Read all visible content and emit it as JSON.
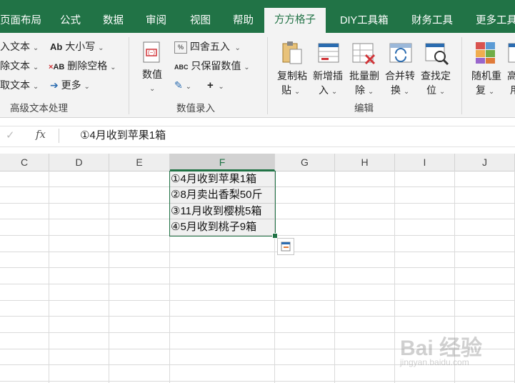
{
  "tabs": [
    {
      "label": "页面布局"
    },
    {
      "label": "公式"
    },
    {
      "label": "数据"
    },
    {
      "label": "审阅"
    },
    {
      "label": "视图"
    },
    {
      "label": "帮助"
    },
    {
      "label": "方方格子"
    },
    {
      "label": "DIY工具箱"
    },
    {
      "label": "财务工具"
    },
    {
      "label": "更多工具"
    }
  ],
  "active_tab": "方方格子",
  "ribbon": {
    "text_group": {
      "left_items": [
        "入文本",
        "除文本",
        "取文本"
      ],
      "case_label": "大小写",
      "remove_space_label": "删除空格",
      "more_label": "更多",
      "group_label": "高级文本处理"
    },
    "number_group": {
      "value_label": "数值",
      "round_label": "四舍五入",
      "keep_value_label": "只保留数值",
      "group_label": "数值录入"
    },
    "edit_group": {
      "copy_paste_line1": "复制粘",
      "copy_paste_line2": "贴",
      "insert_line1": "新增插",
      "insert_line2": "入",
      "batch_delete_line1": "批量删",
      "batch_delete_line2": "除",
      "merge_line1": "合并转",
      "merge_line2": "换",
      "find_line1": "查找定",
      "find_line2": "位",
      "group_label": "编辑"
    },
    "more_group": {
      "random_line1": "随机重",
      "random_line2": "复",
      "high_line1": "高",
      "high_line2": "用"
    }
  },
  "formula_bar": {
    "cancel": "✓",
    "fx": "fx",
    "content": "①4月收到苹果1箱"
  },
  "columns": [
    "C",
    "D",
    "E",
    "F",
    "G",
    "H",
    "I",
    "J"
  ],
  "selected_column": "F",
  "cells": [
    "①4月收到苹果1箱",
    "②8月卖出香梨50斤",
    "③11月收到樱桃5箱",
    "④5月收到桃子9箱"
  ],
  "watermark": {
    "main": "Bai 经验",
    "sub": "jingyan.baidu.com"
  }
}
